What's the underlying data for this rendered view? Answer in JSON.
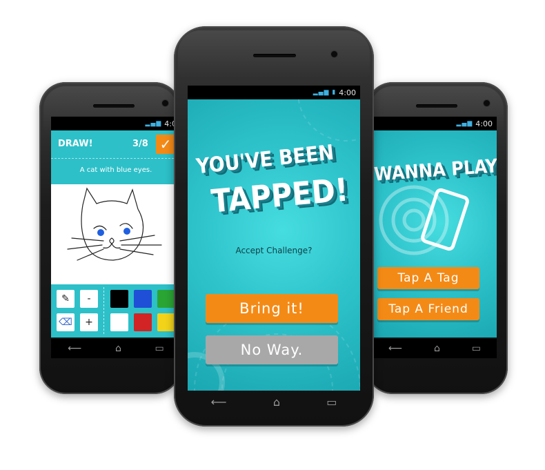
{
  "left_phone": {
    "status_time": "4:0",
    "header_title": "DRAW!",
    "progress": "3/8",
    "prompt": "A cat with blue eyes.",
    "tools": {
      "pen": "✎",
      "minus": "-",
      "eraser": "⌫",
      "plus": "+"
    },
    "colors": [
      "#000000",
      "#1f4fd6",
      "#2aa534",
      "#ffffff",
      "#d22424",
      "#f2d31a"
    ]
  },
  "center_phone": {
    "status_time": "4:00",
    "title_line1": "YOU'VE BEEN",
    "title_line2": "TAPPED!",
    "subtitle": "Accept Challenge?",
    "accept_button": "Bring it!",
    "decline_button": "No Way."
  },
  "right_phone": {
    "status_time": "4:00",
    "title": "WANNA PLAY?",
    "tag_button": "Tap A Tag",
    "friend_button": "Tap A Friend"
  },
  "icons": {
    "back": "⟵",
    "home": "⌂",
    "recent": "▭"
  }
}
